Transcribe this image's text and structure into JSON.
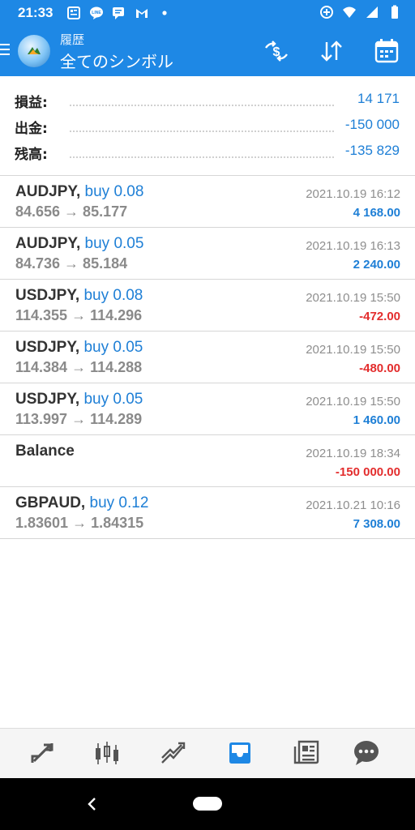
{
  "statusbar": {
    "time": "21:33"
  },
  "appbar": {
    "subtitle": "履歴",
    "title": "全てのシンボル",
    "actions": [
      "currency-swap-icon",
      "sort-icon",
      "calendar-icon"
    ]
  },
  "summary": {
    "profit_label": "損益:",
    "profit_value": "14 171",
    "deposit_label": "出金:",
    "deposit_value": "-150 000",
    "balance_label": "残高:",
    "balance_value": "-135 829"
  },
  "trades": [
    {
      "symbol": "AUDJPY,",
      "side": "buy 0.08",
      "prices": "84.656 → 85.177",
      "time": "2021.10.19 16:12",
      "profit": "4 168.00",
      "sign": "pos"
    },
    {
      "symbol": "AUDJPY,",
      "side": "buy 0.05",
      "prices": "84.736 → 85.184",
      "time": "2021.10.19 16:13",
      "profit": "2 240.00",
      "sign": "pos"
    },
    {
      "symbol": "USDJPY,",
      "side": "buy 0.08",
      "prices": "114.355 → 114.296",
      "time": "2021.10.19 15:50",
      "profit": "-472.00",
      "sign": "neg"
    },
    {
      "symbol": "USDJPY,",
      "side": "buy 0.05",
      "prices": "114.384 → 114.288",
      "time": "2021.10.19 15:50",
      "profit": "-480.00",
      "sign": "neg"
    },
    {
      "symbol": "USDJPY,",
      "side": "buy 0.05",
      "prices": "113.997 → 114.289",
      "time": "2021.10.19 15:50",
      "profit": "1 460.00",
      "sign": "pos"
    },
    {
      "symbol": "Balance",
      "side": "",
      "prices": "",
      "time": "2021.10.19 18:34",
      "profit": "-150 000.00",
      "sign": "neg"
    },
    {
      "symbol": "GBPAUD,",
      "side": "buy 0.12",
      "prices": "1.83601 → 1.84315",
      "time": "2021.10.21 10:16",
      "profit": "7 308.00",
      "sign": "pos"
    }
  ],
  "bottomnav": {
    "items": [
      "quotes-icon",
      "chart-icon",
      "trade-icon",
      "history-icon",
      "news-icon",
      "chat-icon"
    ],
    "active": "history-icon"
  },
  "colors": {
    "primary": "#1e88e5",
    "positive": "#1e7fd6",
    "negative": "#e32d2d"
  }
}
